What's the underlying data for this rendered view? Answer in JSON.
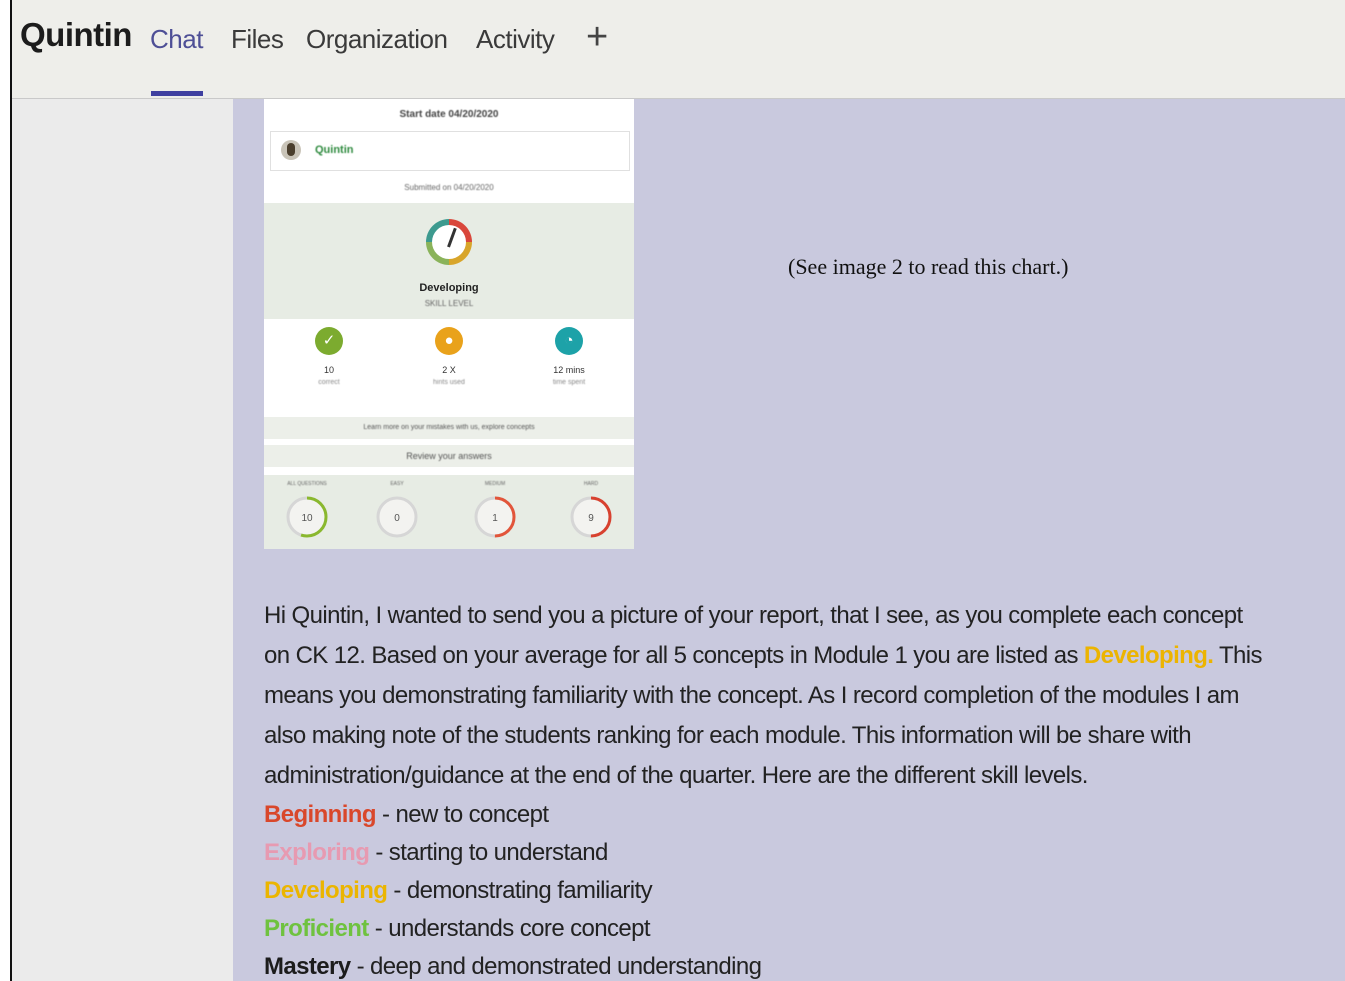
{
  "header": {
    "title": "Quintin",
    "tabs": [
      {
        "label": "Chat",
        "active": true
      },
      {
        "label": "Files",
        "active": false
      },
      {
        "label": "Organization",
        "active": false
      },
      {
        "label": "Activity",
        "active": false
      }
    ],
    "add_tab_icon": "plus-icon"
  },
  "report": {
    "start_date": "Start date 04/20/2020",
    "student": "Quintin",
    "submitted": "Submitted on 04/20/2020",
    "level": "Developing",
    "level_sub": "SKILL LEVEL",
    "stats": [
      {
        "icon": "check-icon",
        "value": "10",
        "caption": "correct",
        "color": "#7cab2f"
      },
      {
        "icon": "bulb-icon",
        "value": "2 X",
        "caption": "hints used",
        "color": "#e9a21b"
      },
      {
        "icon": "timer-icon",
        "value": "12 mins",
        "caption": "time spent",
        "color": "#1da2a8"
      }
    ],
    "learn_text": "Learn more on your mistakes with us, explore concepts",
    "review_text": "Review your answers",
    "rings": [
      {
        "label": "ALL QUESTIONS",
        "value": "10",
        "color": "#8ab82e",
        "fraction": 0.55
      },
      {
        "label": "EASY",
        "value": "0",
        "color": "#bdbdbd",
        "fraction": 0.0
      },
      {
        "label": "MEDIUM",
        "value": "1",
        "color": "#e2553a",
        "fraction": 0.5
      },
      {
        "label": "HARD",
        "value": "9",
        "color": "#d8412f",
        "fraction": 0.5
      }
    ]
  },
  "chart_note": "(See image 2 to read this chart.)",
  "message": {
    "lines": [
      "Hi Quintin, I wanted to send you a picture of your report, that I see, as you complete each concept",
      "means you demonstrating familiarity with the concept.  As I record completion of the modules I am",
      "also making note of the students ranking for each module. This information will be share with",
      "administration/guidance at the end of the quarter. Here are the different skill levels."
    ],
    "line2_before": "on CK 12. Based on your average for all 5 concepts in Module 1 you are listed as ",
    "line2_highlight": "Developing.",
    "line2_after": "  This",
    "levels": [
      {
        "name": "Beginning",
        "desc": " - new to concept",
        "color": "#d9472b"
      },
      {
        "name": "Exploring",
        "desc": " - starting to understand",
        "color": "#e79ab1"
      },
      {
        "name": "Developing",
        "desc": " - demonstrating familiarity",
        "color": "#ebb500"
      },
      {
        "name": "Proficient",
        "desc": " - understands core concept",
        "color": "#6fc23f"
      },
      {
        "name": "Mastery",
        "desc": " - deep and demonstrated understanding",
        "color": "#1c1c1c"
      }
    ]
  }
}
